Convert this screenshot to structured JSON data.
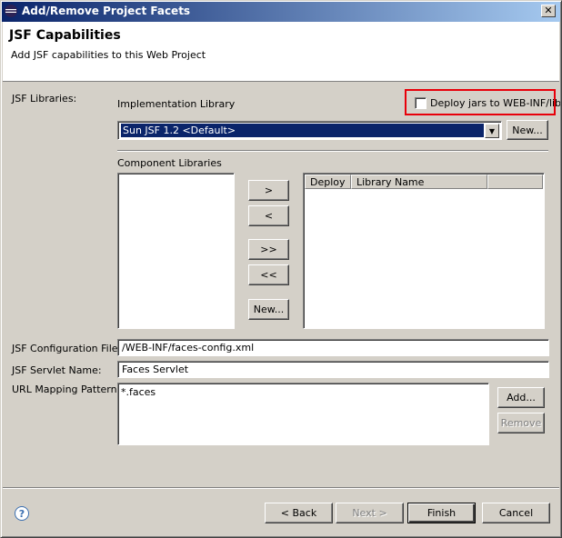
{
  "window": {
    "title": "Add/Remove Project Facets",
    "close_glyph": "✕"
  },
  "banner": {
    "title": "JSF Capabilities",
    "description": "Add JSF capabilities to this Web Project"
  },
  "jsf_libraries": {
    "section_label": "JSF Libraries:",
    "implementation_label": "Implementation Library",
    "deploy_checkbox_label": "Deploy jars to WEB-INF/lib",
    "deploy_checked": false,
    "implementation_value": "Sun JSF 1.2 <Default>",
    "new_button": "New..."
  },
  "component_libraries": {
    "label": "Component Libraries",
    "available_items": [],
    "add_button": ">",
    "remove_button": "<",
    "add_all_button": ">>",
    "remove_all_button": "<<",
    "new_button": "New...",
    "table_columns": [
      "Deploy",
      "Library Name",
      ""
    ],
    "table_rows": []
  },
  "config": {
    "config_file_label": "JSF Configuration File:",
    "config_file_value": "/WEB-INF/faces-config.xml",
    "servlet_name_label": "JSF Servlet Name:",
    "servlet_name_value": "Faces Servlet",
    "url_patterns_label": "URL Mapping Patterns:",
    "url_patterns": [
      "*.faces"
    ],
    "add_button": "Add...",
    "remove_button": "Remove"
  },
  "footer": {
    "help_glyph": "?",
    "back_button": "< Back",
    "next_button": "Next >",
    "finish_button": "Finish",
    "cancel_button": "Cancel"
  },
  "colors": {
    "accent_highlight": "#e8000a",
    "title_bar": "#0a246a",
    "selection": "#0a246a"
  },
  "icons": [
    "eclipse-icon",
    "close-icon",
    "help-icon",
    "dropdown-arrow-icon"
  ]
}
